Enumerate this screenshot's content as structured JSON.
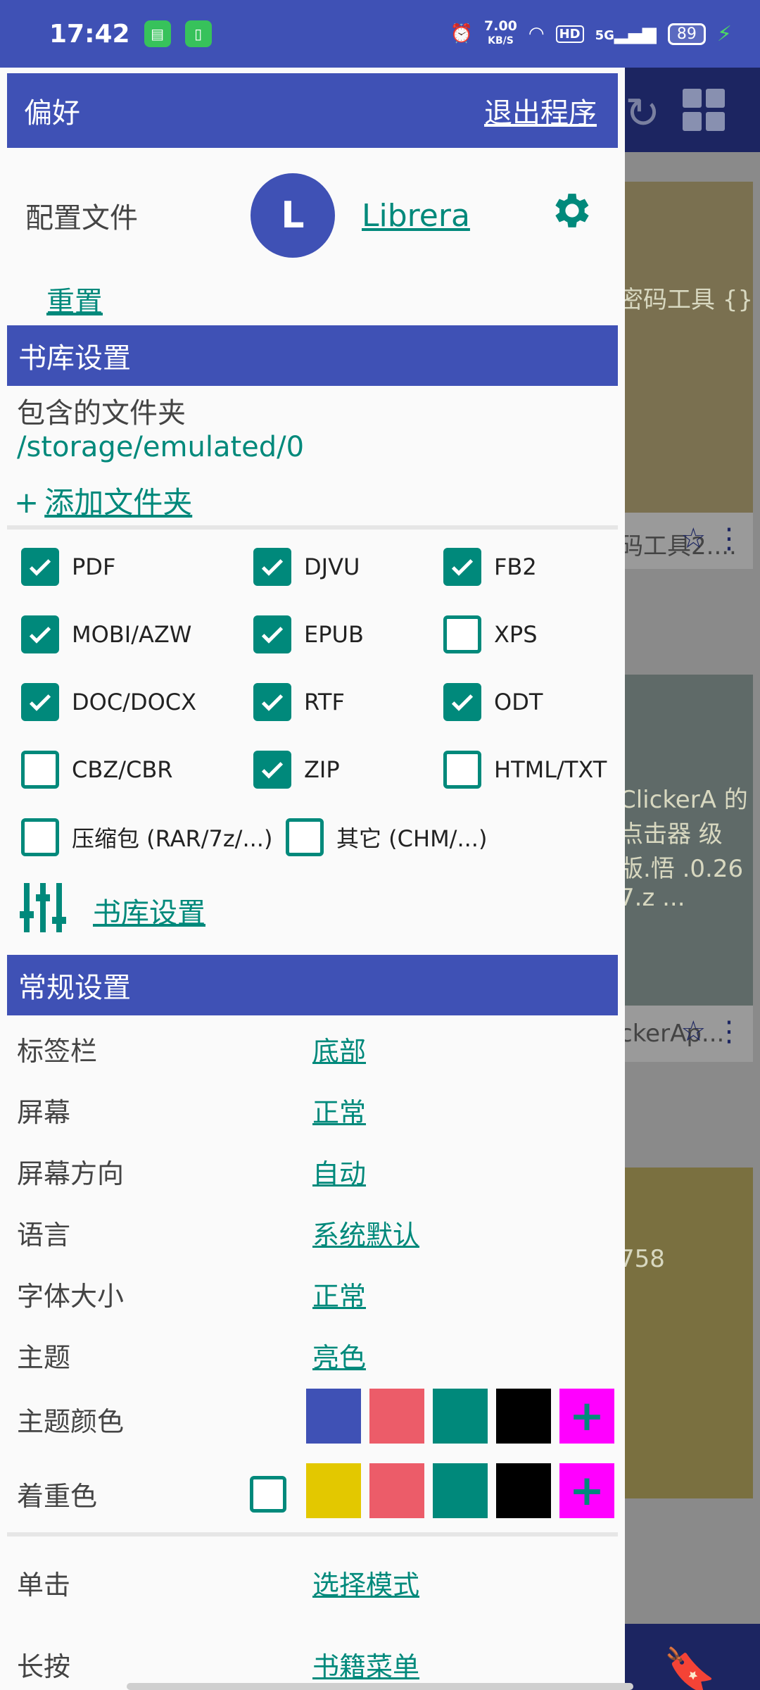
{
  "status_bar": {
    "time": "17:42",
    "net_speed_value": "7.00",
    "net_speed_unit": "KB/S",
    "hd": "HD",
    "signal": "5G",
    "battery": "89"
  },
  "background_app": {
    "cards": [
      {
        "cover": "密码工具 {} Wifi密 具2.1",
        "title": "码工具2...."
      },
      {
        "cover": "ClickerA 的点击器 级版.悟 .0.26 7.z ...",
        "title": "ckerAp..."
      },
      {
        "cover": "758",
        "title": ""
      }
    ],
    "bottom_nav_label": "书签"
  },
  "drawer": {
    "header": {
      "title": "偏好",
      "exit": "退出程序"
    },
    "profile": {
      "label": "配置文件",
      "avatar_letter": "L",
      "name": "Librera",
      "reset": "重置"
    },
    "library": {
      "section_title": "书库设置",
      "folders_label": "包含的文件夹",
      "folder_path": "/storage/emulated/0",
      "add_folder_plus": "+",
      "add_folder": "添加文件夹",
      "formats": [
        {
          "label": "PDF",
          "checked": true
        },
        {
          "label": "DJVU",
          "checked": true
        },
        {
          "label": "FB2",
          "checked": true
        },
        {
          "label": "MOBI/AZW",
          "checked": true
        },
        {
          "label": "EPUB",
          "checked": true
        },
        {
          "label": "XPS",
          "checked": false
        },
        {
          "label": "DOC/DOCX",
          "checked": true
        },
        {
          "label": "RTF",
          "checked": true
        },
        {
          "label": "ODT",
          "checked": true
        },
        {
          "label": "CBZ/CBR",
          "checked": false
        },
        {
          "label": "ZIP",
          "checked": true
        },
        {
          "label": "HTML/TXT",
          "checked": false
        },
        {
          "label": "压缩包 (RAR/7z/...)",
          "checked": false
        },
        {
          "label": "其它 (CHM/...)",
          "checked": false
        }
      ],
      "settings_link": "书库设置"
    },
    "general": {
      "section_title": "常规设置",
      "rows": [
        {
          "label": "标签栏",
          "value": "底部"
        },
        {
          "label": "屏幕",
          "value": "正常"
        },
        {
          "label": "屏幕方向",
          "value": "自动"
        },
        {
          "label": "语言",
          "value": "系统默认"
        },
        {
          "label": "字体大小",
          "value": "正常"
        },
        {
          "label": "主题",
          "value": "亮色"
        }
      ],
      "theme_color_label": "主题颜色",
      "theme_colors": [
        "#3f51b5",
        "#ec5c69",
        "#00897b",
        "#000000",
        "#ff00ff"
      ],
      "accent_color_label": "着重色",
      "accent_colors": [
        "#e3c800",
        "#ec5c69",
        "#00897b",
        "#000000",
        "#ff00ff"
      ],
      "add_color_symbol": "+",
      "click_rows": [
        {
          "label": "单击",
          "value": "选择模式"
        },
        {
          "label": "长按",
          "value": "书籍菜单"
        }
      ]
    }
  }
}
